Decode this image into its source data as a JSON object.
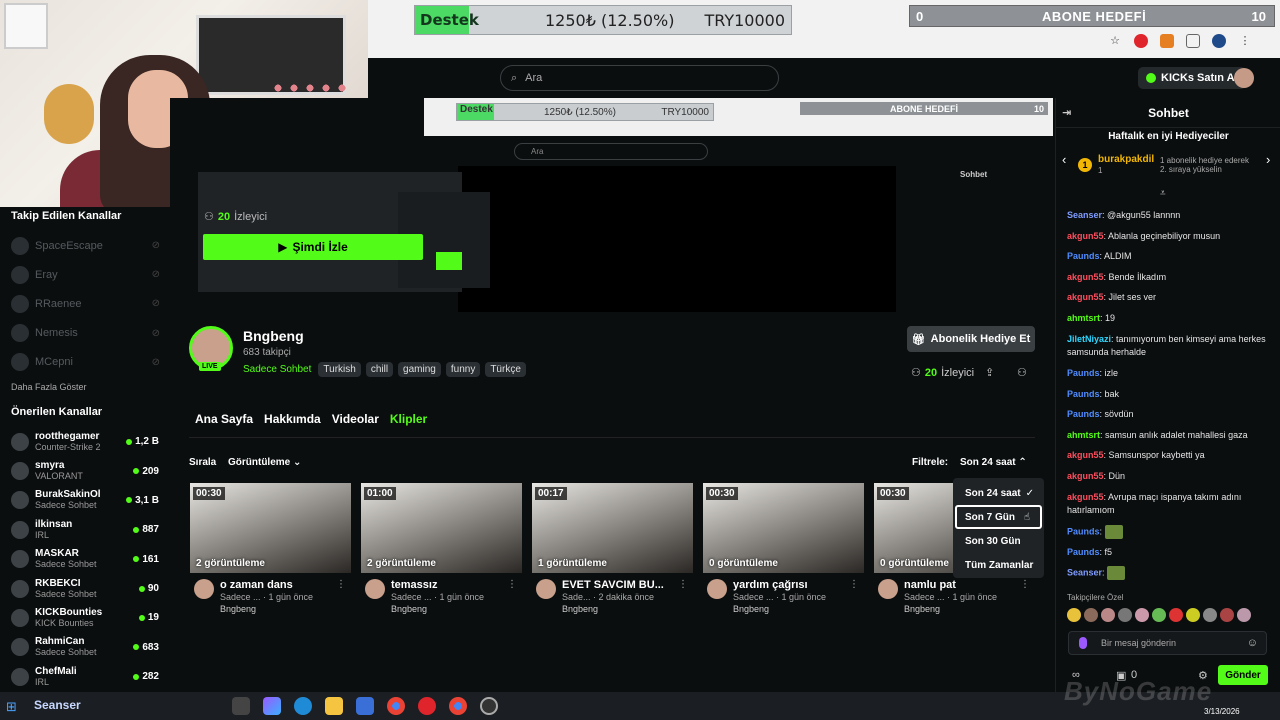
{
  "overlay": {
    "goal_label": "Destek",
    "goal_amount": "1250₺ (12.50%)",
    "goal_target": "TRY10000",
    "sub_left": "0",
    "sub_title": "ABONE HEDEFİ",
    "sub_right": "10"
  },
  "header": {
    "search_placeholder": "Ara",
    "kicks_button": "KICKs Satın Al"
  },
  "player": {
    "nested_goal": "Destek",
    "nested_amount": "1250₺ (12.50%)",
    "nested_target": "TRY10000",
    "nested_sub": "ABONE HEDEFİ",
    "nested_sub_right": "10",
    "nested_search": "Ara",
    "nested_chat": "Sohbet",
    "viewers_count": "20",
    "viewers_label": "İzleyici",
    "watch_now": "Şimdi İzle"
  },
  "sidebar": {
    "followed_title": "Takip Edilen Kanallar",
    "followed": [
      {
        "name": "SpaceEscape"
      },
      {
        "name": "Eray"
      },
      {
        "name": "RRaenee"
      },
      {
        "name": "Nemesis"
      },
      {
        "name": "MCepni"
      }
    ],
    "show_more": "Daha Fazla Göster",
    "recommended_title": "Önerilen Kanallar",
    "recommended": [
      {
        "name": "rootthegamer",
        "category": "Counter-Strike 2",
        "count": "1,2 B"
      },
      {
        "name": "smyra",
        "category": "VALORANT",
        "count": "209"
      },
      {
        "name": "BurakSakinOl",
        "category": "Sadece Sohbet",
        "count": "3,1 B"
      },
      {
        "name": "ilkinsan",
        "category": "IRL",
        "count": "887"
      },
      {
        "name": "MASKAR",
        "category": "Sadece Sohbet",
        "count": "161"
      },
      {
        "name": "RKBEKCI",
        "category": "Sadece Sohbet",
        "count": "90"
      },
      {
        "name": "KICKBounties",
        "category": "KICK Bounties",
        "count": "19"
      },
      {
        "name": "RahmiCan",
        "category": "Sadece Sohbet",
        "count": "683"
      },
      {
        "name": "ChefMali",
        "category": "IRL",
        "count": "282"
      }
    ]
  },
  "channel": {
    "name": "Bngbeng",
    "followers": "683 takipçi",
    "live": "LIVE",
    "category": "Sadece Sohbet",
    "tags": [
      "Turkish",
      "chill",
      "gaming",
      "funny",
      "Türkçe"
    ],
    "gift_button": "Abonelik Hediye Et",
    "viewers_count": "20",
    "viewers_label": "İzleyici"
  },
  "tabs": [
    "Ana Sayfa",
    "Hakkımda",
    "Videolar",
    "Klipler"
  ],
  "active_tab": "Klipler",
  "sort": {
    "label": "Sırala",
    "value": "Görüntüleme"
  },
  "filter": {
    "label": "Filtrele:",
    "value": "Son 24 saat"
  },
  "dropdown": [
    {
      "label": "Son 24 saat",
      "check": "✓"
    },
    {
      "label": "Son 7 Gün",
      "check": ""
    },
    {
      "label": "Son 30 Gün",
      "check": ""
    },
    {
      "label": "Tüm Zamanlar",
      "check": ""
    }
  ],
  "clips": [
    {
      "duration": "00:30",
      "views": "2 görüntüleme",
      "title": "o zaman dans",
      "meta": "Sadece ... · 1 gün önce",
      "channel": "Bngbeng"
    },
    {
      "duration": "01:00",
      "views": "2 görüntüleme",
      "title": "temassız",
      "meta": "Sadece ... · 1 gün önce",
      "channel": "Bngbeng"
    },
    {
      "duration": "00:17",
      "views": "1 görüntüleme",
      "title": "EVET SAVCIM BU...",
      "meta": "Sade... · 2 dakika önce",
      "channel": "Bngbeng"
    },
    {
      "duration": "00:30",
      "views": "0 görüntüleme",
      "title": "yardım çağrısı",
      "meta": "Sadece ... · 1 gün önce",
      "channel": "Bngbeng"
    },
    {
      "duration": "00:30",
      "views": "0 görüntüleme",
      "title": "namlu pat",
      "meta": "Sadece ... · 1 gün önce",
      "channel": "Bngbeng"
    }
  ],
  "chat": {
    "title": "Sohbet",
    "gifters_title": "Haftalık en iyi Hediyeciler",
    "top_gifter": "burakpakdil",
    "top_gifter_count": "1",
    "gifter_next": "1 abonelik hediye ederek 2. sıraya yükselin",
    "messages": [
      {
        "user": "Seanser",
        "color": "#7f9cff",
        "text": "@akgun55 lannnn"
      },
      {
        "user": "akgun55",
        "color": "#ff4d5e",
        "text": "Ablanla geçinebiliyor musun"
      },
      {
        "user": "Paunds",
        "color": "#4f8cff",
        "text": "ALDIM"
      },
      {
        "user": "akgun55",
        "color": "#ff4d5e",
        "text": "Bende İlkadım"
      },
      {
        "user": "akgun55",
        "color": "#ff4d5e",
        "text": "Jilet ses ver"
      },
      {
        "user": "ahmtsrt",
        "color": "#53fc18",
        "text": "19"
      },
      {
        "user": "JiletNiyazi",
        "color": "#2fd7ff",
        "text": "tanımıyorum ben kimseyi ama herkes samsunda herhalde"
      },
      {
        "user": "Paunds",
        "color": "#4f8cff",
        "text": "izle"
      },
      {
        "user": "Paunds",
        "color": "#4f8cff",
        "text": "bak"
      },
      {
        "user": "Paunds",
        "color": "#4f8cff",
        "text": "sövdün"
      },
      {
        "user": "ahmtsrt",
        "color": "#53fc18",
        "text": "samsun anlık adalet mahallesi gaza"
      },
      {
        "user": "akgun55",
        "color": "#ff4d5e",
        "text": "Samsunspor kaybetti ya"
      },
      {
        "user": "akgun55",
        "color": "#ff4d5e",
        "text": "Dün"
      },
      {
        "user": "akgun55",
        "color": "#ff4d5e",
        "text": "Avrupa maçı ispanya takımı adını hatırlamıom"
      },
      {
        "user": "Paunds",
        "color": "#4f8cff",
        "text": ""
      },
      {
        "user": "Paunds",
        "color": "#4f8cff",
        "text": "f5"
      },
      {
        "user": "Seanser",
        "color": "#7f9cff",
        "text": ""
      }
    ],
    "follower_special": "Takipçilere Özel",
    "input_placeholder": "Bir mesaj gönderin",
    "kicks_count": "0",
    "send": "Gönder"
  },
  "taskbar": {
    "label": "Seanser",
    "date": "3/13/2026"
  },
  "watermark": "ByNoGame"
}
